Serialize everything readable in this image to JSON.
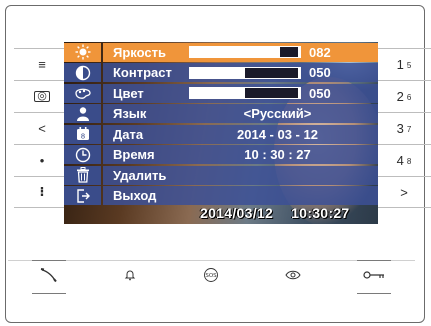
{
  "left_buttons": [
    {
      "name": "menu-icon",
      "glyph": "≡"
    },
    {
      "name": "camera-icon",
      "glyph": "⌷"
    },
    {
      "name": "back-icon",
      "glyph": "<"
    },
    {
      "name": "dot-icon",
      "glyph": "•"
    },
    {
      "name": "more-icon",
      "glyph": "⁝"
    }
  ],
  "right_buttons": [
    {
      "main": "1",
      "sub": "5"
    },
    {
      "main": "2",
      "sub": "6"
    },
    {
      "main": "3",
      "sub": "7"
    },
    {
      "main": "4",
      "sub": "8"
    },
    {
      "main": ">",
      "sub": ""
    }
  ],
  "menu": {
    "brightness": {
      "label": "Яркость",
      "value": "082",
      "level": 0.82
    },
    "contrast": {
      "label": "Контраст",
      "value": "050",
      "level": 0.5
    },
    "color": {
      "label": "Цвет",
      "value": "050",
      "level": 0.5
    },
    "language": {
      "label": "Язык",
      "value": "<Русский>"
    },
    "date": {
      "label": "Дата",
      "value": "2014 - 03 - 12"
    },
    "time": {
      "label": "Время",
      "value": "10 : 30 : 27"
    },
    "delete": {
      "label": "Удалить"
    },
    "exit": {
      "label": "Выход"
    }
  },
  "stamp": {
    "date": "2014/03/12",
    "time": "10:30:27"
  },
  "colors": {
    "active": "#f0953a",
    "row": "#3a4c8a"
  }
}
